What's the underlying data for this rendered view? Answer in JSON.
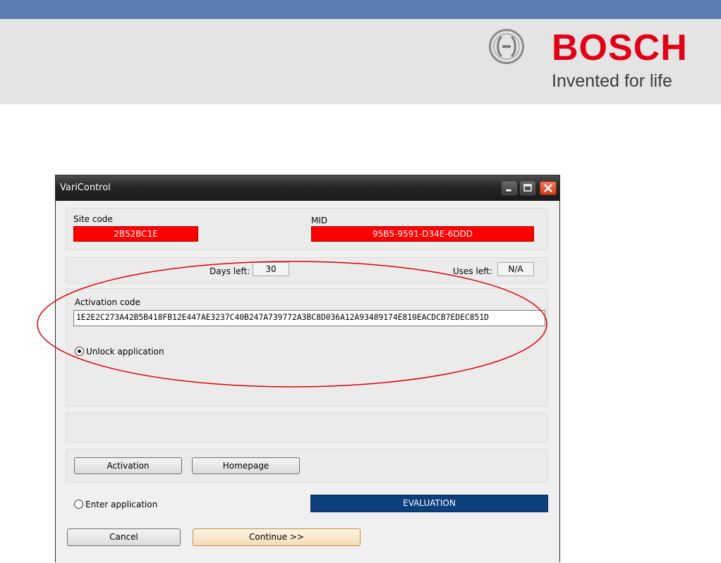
{
  "brand": {
    "name": "BOSCH",
    "tagline": "Invented for life",
    "colors": {
      "stripe": "#5a7db1",
      "banner": "#e4e4e4",
      "wordmark": "#e10018"
    }
  },
  "window": {
    "title": "VariControl",
    "controls": [
      "minimize-icon",
      "maximize-icon",
      "close-icon"
    ]
  },
  "site": {
    "site_code_label": "Site code",
    "site_code_value": "2B52BC1E",
    "mid_label": "MID",
    "mid_value": "95B5-9591-D34E-6DDD"
  },
  "usage": {
    "days_left_label": "Days left:",
    "days_left_value": "30",
    "uses_left_label": "Uses left:",
    "uses_left_value": "N/A"
  },
  "activation": {
    "label": "Activation code",
    "code": "1E2E2C273A42B5B418FB12E447AE3237C40B247A739772A3BC8D036A12A93489174E810EACDCB7EDEC851D",
    "unlock_option": "Unlock application",
    "unlock_selected": true
  },
  "buttons": {
    "activation": "Activation",
    "homepage": "Homepage",
    "cancel": "Cancel",
    "continue": "Continue >>"
  },
  "enter_option": {
    "label": "Enter application",
    "selected": false
  },
  "status": {
    "text": "EVALUATION",
    "color": "#0c3f7c"
  },
  "colors": {
    "highlight": "#ff0000",
    "annotation": "#e00000"
  }
}
